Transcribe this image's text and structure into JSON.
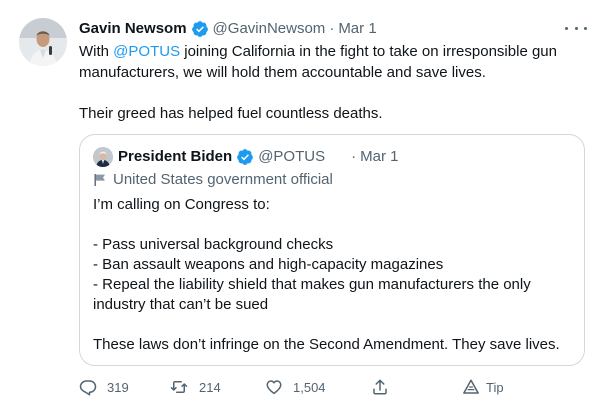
{
  "tweet": {
    "author": {
      "name": "Gavin Newsom",
      "handle": "@GavinNewsom",
      "separator": "·",
      "date": "Mar 1"
    },
    "text": {
      "prefix": "With ",
      "mention": "@POTUS",
      "rest": " joining California in the fight to take on irresponsible gun manufacturers, we will hold them accountable and save lives.",
      "paragraph2": "Their greed has helped fuel countless deaths."
    }
  },
  "quote": {
    "author": {
      "name": "President Biden",
      "handle": "@POTUS",
      "separator": "·",
      "date": "Mar 1"
    },
    "label": "United States government official",
    "lines": [
      "I’m calling on Congress to:",
      "",
      "- Pass universal background checks",
      "- Ban assault weapons and high-capacity magazines",
      "- Repeal the liability shield that makes gun manufacturers the only",
      "industry that can’t be sued",
      "",
      "These laws don’t infringe on the Second Amendment. They save lives."
    ]
  },
  "actions": {
    "reply": {
      "count": "319",
      "icon": "reply-icon"
    },
    "retweet": {
      "count": "214",
      "icon": "retweet-icon"
    },
    "like": {
      "count": "1,504",
      "icon": "heart-icon"
    },
    "share": {
      "icon": "share-icon"
    },
    "tip": {
      "label": "Tip",
      "icon": "tip-icon"
    }
  },
  "colors": {
    "accent": "#1d9bf0",
    "text": "#0f1419",
    "secondary": "#536471",
    "border": "#cfd9de"
  }
}
